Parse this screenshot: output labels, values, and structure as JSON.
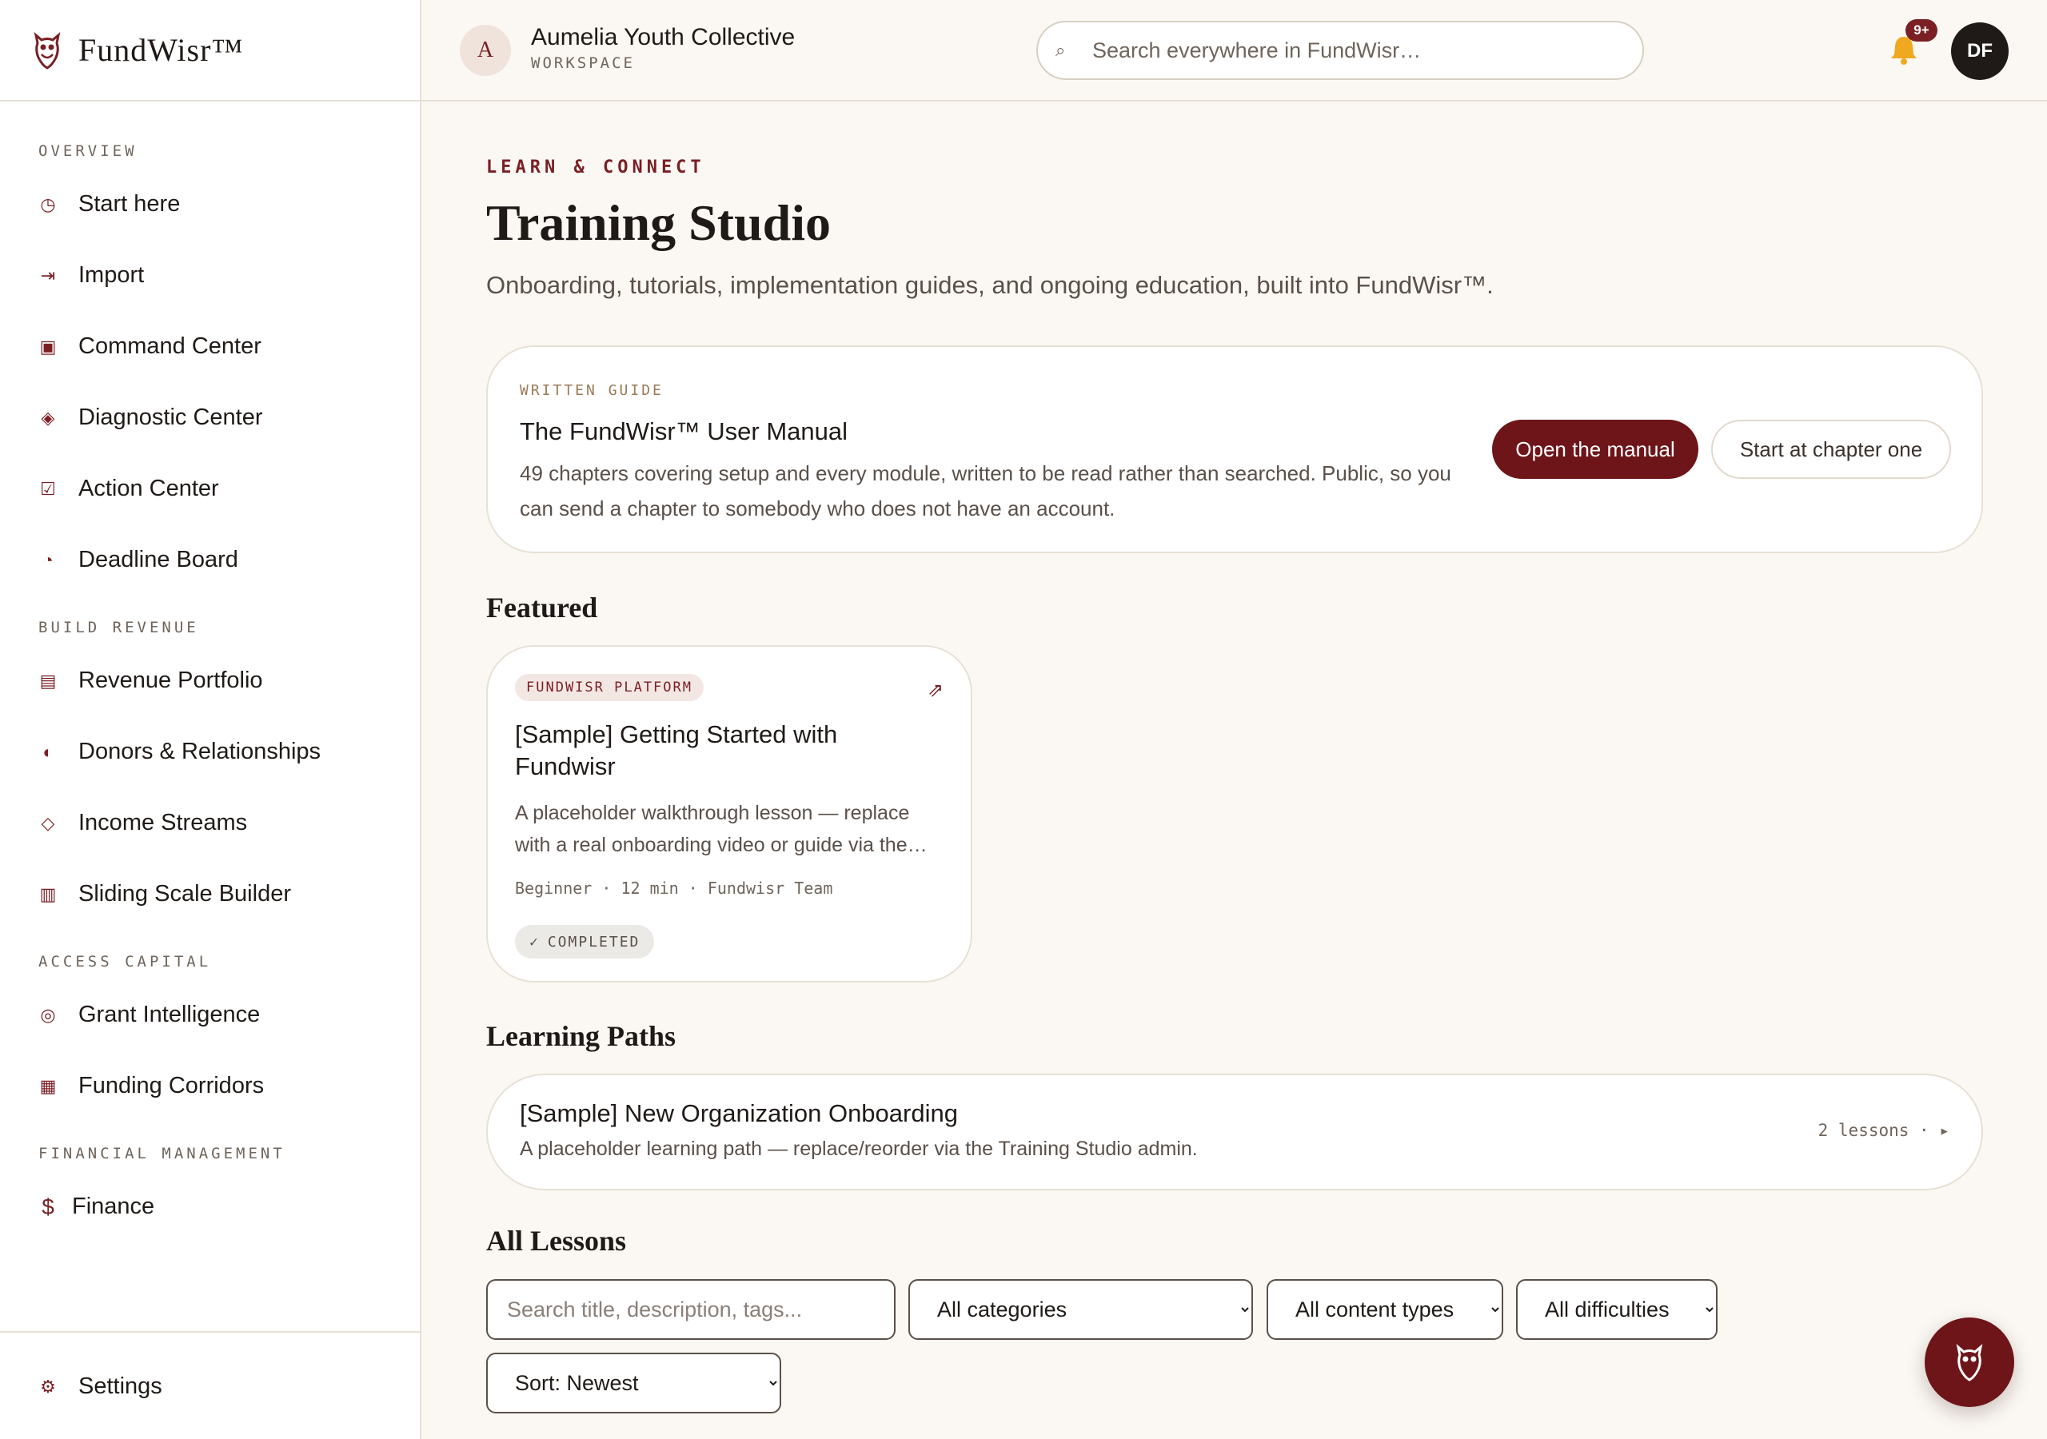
{
  "brand": {
    "name": "FundWisr™"
  },
  "nav": {
    "sections": [
      {
        "label": "OVERVIEW",
        "items": [
          {
            "label": "Start here",
            "icon": "clock-icon"
          },
          {
            "label": "Import",
            "icon": "import-arrow-icon"
          },
          {
            "label": "Command Center",
            "icon": "square-icon"
          },
          {
            "label": "Diagnostic Center",
            "icon": "diamond-icon"
          },
          {
            "label": "Action Center",
            "icon": "checkbox-icon"
          },
          {
            "label": "Deadline Board",
            "icon": "pie-icon"
          }
        ]
      },
      {
        "label": "BUILD REVENUE",
        "items": [
          {
            "label": "Revenue Portfolio",
            "icon": "list-icon"
          },
          {
            "label": "Donors & Relationships",
            "icon": "half-circle-icon"
          },
          {
            "label": "Income Streams",
            "icon": "diamond-outline-icon"
          },
          {
            "label": "Sliding Scale Builder",
            "icon": "columns-icon"
          }
        ]
      },
      {
        "label": "ACCESS CAPITAL",
        "items": [
          {
            "label": "Grant Intelligence",
            "icon": "target-icon"
          },
          {
            "label": "Funding Corridors",
            "icon": "grid-icon"
          }
        ]
      },
      {
        "label": "FINANCIAL MANAGEMENT",
        "items": [
          {
            "label": "Finance",
            "icon": "dollar-icon"
          }
        ]
      }
    ],
    "footer": {
      "label": "Settings",
      "icon": "gear-icon"
    }
  },
  "topbar": {
    "workspace_initial": "A",
    "workspace_name": "Aumelia Youth Collective",
    "workspace_sub": "WORKSPACE",
    "search_placeholder": "Search everywhere in FundWisr…",
    "notification_badge": "9+",
    "user_initials": "DF"
  },
  "page": {
    "eyebrow": "LEARN & CONNECT",
    "title": "Training Studio",
    "subtitle": "Onboarding, tutorials, implementation guides, and ongoing education, built into FundWisr™."
  },
  "manual": {
    "label": "WRITTEN GUIDE",
    "title": "The FundWisr™ User Manual",
    "description": "49 chapters covering setup and every module, written to be read rather than searched. Public, so you can send a chapter to somebody who does not have an account.",
    "primary_button": "Open the manual",
    "secondary_button": "Start at chapter one"
  },
  "featured": {
    "heading": "Featured",
    "lesson": {
      "tag": "FUNDWISR PLATFORM",
      "title": "[Sample] Getting Started with Fundwisr",
      "description": "A placeholder walkthrough lesson — replace with a real onboarding video or guide via the…",
      "meta": "Beginner · 12 min · Fundwisr Team",
      "status": "COMPLETED"
    }
  },
  "paths": {
    "heading": "Learning Paths",
    "items": [
      {
        "title": "[Sample] New Organization Onboarding",
        "description": "A placeholder learning path — replace/reorder via the Training Studio admin.",
        "meta": "2 lessons · ▸"
      }
    ]
  },
  "lessons": {
    "heading": "All Lessons",
    "search_placeholder": "Search title, description, tags...",
    "category_select": "All categories",
    "type_select": "All content types",
    "difficulty_select": "All difficulties",
    "sort_select": "Sort: Newest"
  },
  "colors": {
    "accent": "#7a1f24",
    "background": "#fbf8f3"
  }
}
